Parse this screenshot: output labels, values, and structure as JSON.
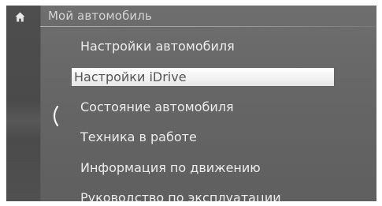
{
  "header": {
    "title": "Мой автомобиль",
    "home_icon": "home-icon",
    "back_icon": "chevron-left-icon"
  },
  "menu": {
    "items": [
      {
        "label": "Настройки автомобиля",
        "selected": false
      },
      {
        "label": "Настройки iDrive",
        "selected": true
      },
      {
        "label": "Состояние автомобиля",
        "selected": false
      },
      {
        "label": "Техника в работе",
        "selected": false
      },
      {
        "label": "Информация по движению",
        "selected": false
      },
      {
        "label": "Руководство по эксплуатации",
        "selected": false
      }
    ]
  },
  "colors": {
    "background": "#666666",
    "rail": "#4c4c4c",
    "text": "#ececec",
    "selected_bg": "#f2f2f2",
    "selected_text": "#555555"
  }
}
